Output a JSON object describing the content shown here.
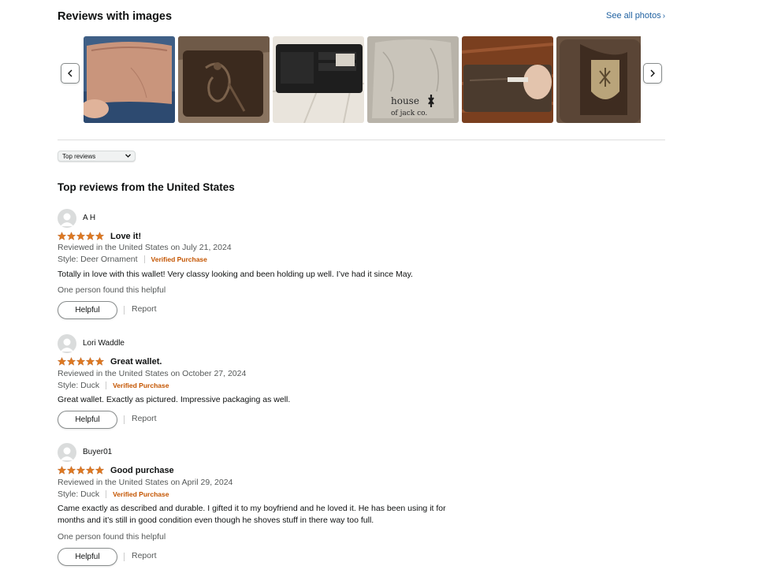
{
  "images_section": {
    "title": "Reviews with images",
    "see_all_label": "See all photos",
    "see_all_chevron": "›",
    "prev_icon": "chevron-left-icon",
    "next_icon": "chevron-right-icon",
    "thumbnails": [
      {
        "name": "photo-tan-wallet-in-hand"
      },
      {
        "name": "photo-embossed-duck-wallet"
      },
      {
        "name": "photo-open-black-wallet"
      },
      {
        "name": "photo-house-of-jack-pouch",
        "text_line1": "house",
        "text_line2": "of jack co."
      },
      {
        "name": "photo-wallet-card-slot"
      },
      {
        "name": "photo-deer-ornament-wallet"
      }
    ]
  },
  "sort": {
    "selected": "Top reviews",
    "caret_icon": "chevron-down-icon"
  },
  "reviews_heading": "Top reviews from the United States",
  "colors": {
    "star": "#de7921",
    "verified": "#c45500",
    "link": "#2162a1",
    "muted": "#565959"
  },
  "reviews": [
    {
      "reviewer": "A H",
      "rating": 5,
      "title": "Love it!",
      "date_line": "Reviewed in the United States on July 21, 2024",
      "style": "Style: Deer Ornament",
      "verified": "Verified Purchase",
      "body": "Totally in love with this wallet! Very classy looking and been holding up well. I’ve had it since May.",
      "helpful_count": "One person found this helpful",
      "helpful_label": "Helpful",
      "report_label": "Report"
    },
    {
      "reviewer": "Lori Waddle",
      "rating": 5,
      "title": "Great wallet.",
      "date_line": "Reviewed in the United States on October 27, 2024",
      "style": "Style: Duck",
      "verified": "Verified Purchase",
      "body": "Great wallet. Exactly as pictured. Impressive packaging as well.",
      "helpful_count": "",
      "helpful_label": "Helpful",
      "report_label": "Report"
    },
    {
      "reviewer": "Buyer01",
      "rating": 5,
      "title": "Good purchase",
      "date_line": "Reviewed in the United States on April 29, 2024",
      "style": "Style: Duck",
      "verified": "Verified Purchase",
      "body": "Came exactly as described and durable. I gifted it to my boyfriend and he loved it. He has been using it for months and it’s still in good condition even though he shoves stuff in there way too full.",
      "helpful_count": "One person found this helpful",
      "helpful_label": "Helpful",
      "report_label": "Report"
    }
  ]
}
